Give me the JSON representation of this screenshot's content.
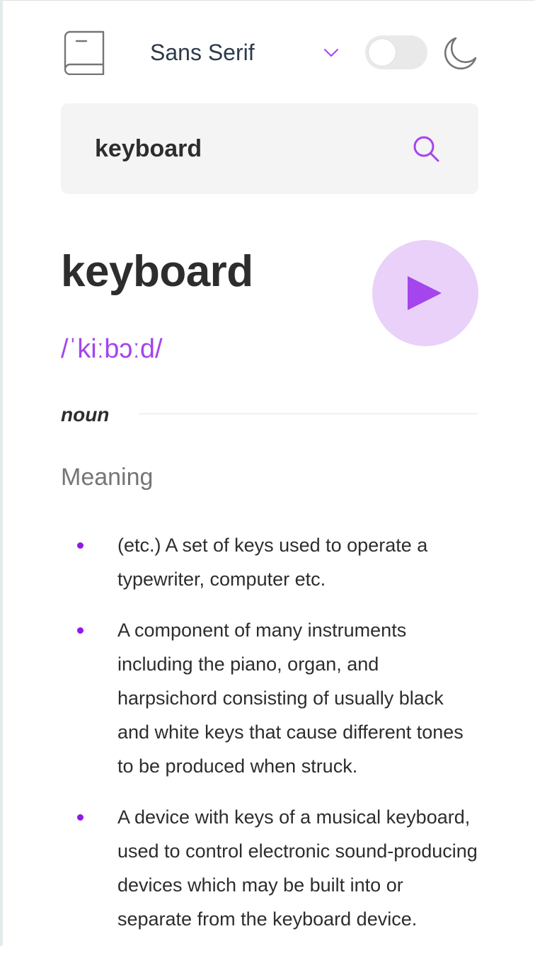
{
  "header": {
    "logo_icon": "book-icon",
    "font_select": {
      "selected": "Sans Serif",
      "icon": "chevron-down-icon"
    },
    "theme_toggle": {
      "state": "off"
    },
    "theme_icon": "moon-icon"
  },
  "search": {
    "value": "keyboard",
    "icon": "search-icon"
  },
  "entry": {
    "word": "keyboard",
    "phonetic": "/ˈkiːbɔːd/",
    "play_icon": "play-icon",
    "meanings": [
      {
        "part_of_speech": "noun",
        "heading": "Meaning",
        "definitions": [
          "(etc.) A set of keys used to operate a typewriter, computer etc.",
          "A component of many instruments including the piano, organ, and harpsichord consisting of usually black and white keys that cause different tones to be produced when struck.",
          "A device with keys of a musical keyboard, used to control electronic sound-producing devices which may be built into or separate from the keyboard device."
        ]
      }
    ]
  },
  "colors": {
    "accent": "#a445ed",
    "accent_light": "#e9d1fa",
    "text": "#2d2d2d",
    "muted": "#757575",
    "search_bg": "#f4f4f4"
  }
}
